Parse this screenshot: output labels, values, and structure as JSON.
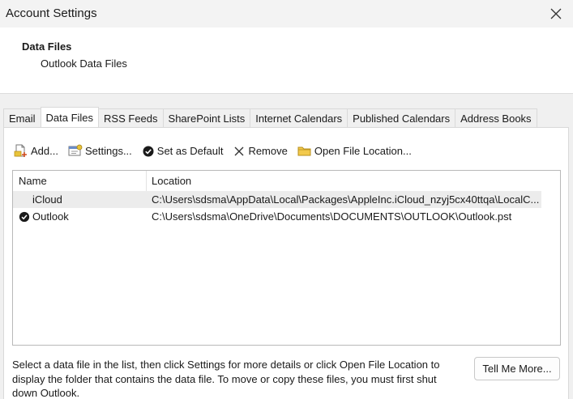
{
  "window": {
    "title": "Account Settings"
  },
  "header": {
    "title": "Data Files",
    "subtitle": "Outlook Data Files"
  },
  "tabs": [
    {
      "label": "Email",
      "active": false
    },
    {
      "label": "Data Files",
      "active": true
    },
    {
      "label": "RSS Feeds",
      "active": false
    },
    {
      "label": "SharePoint Lists",
      "active": false
    },
    {
      "label": "Internet Calendars",
      "active": false
    },
    {
      "label": "Published Calendars",
      "active": false
    },
    {
      "label": "Address Books",
      "active": false
    }
  ],
  "toolbar": {
    "add": "Add...",
    "settings": "Settings...",
    "set_default": "Set as Default",
    "remove": "Remove",
    "open_location": "Open File Location..."
  },
  "list": {
    "columns": {
      "name": "Name",
      "location": "Location"
    },
    "rows": [
      {
        "name": "iCloud",
        "location": "C:\\Users\\sdsma\\AppData\\Local\\Packages\\AppleInc.iCloud_nzyj5cx40ttqa\\LocalC...",
        "default": false,
        "selected": true
      },
      {
        "name": "Outlook",
        "location": "C:\\Users\\sdsma\\OneDrive\\Documents\\DOCUMENTS\\OUTLOOK\\Outlook.pst",
        "default": true,
        "selected": false
      }
    ]
  },
  "footer": {
    "help_text": "Select a data file in the list, then click Settings for more details or click Open File Location to display the folder that contains the data file. To move or copy these files, you must first shut down Outlook.",
    "tell_me_more": "Tell Me More..."
  },
  "icons": {
    "close": "close-icon",
    "add": "add-file-icon",
    "settings": "settings-icon",
    "set_default": "check-circle-icon",
    "remove": "remove-x-icon",
    "open_location": "folder-icon"
  }
}
